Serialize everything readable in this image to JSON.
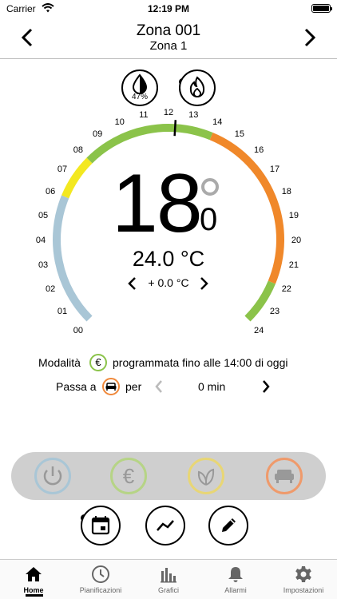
{
  "status": {
    "carrier": "Carrier",
    "time": "12:19 PM"
  },
  "header": {
    "title": "Zona 001",
    "subtitle": "Zona 1"
  },
  "humidity": {
    "value": "47%"
  },
  "gauge": {
    "hours": [
      "00",
      "01",
      "02",
      "03",
      "04",
      "05",
      "06",
      "07",
      "08",
      "09",
      "10",
      "11",
      "12",
      "13",
      "14",
      "15",
      "16",
      "17",
      "18",
      "19",
      "20",
      "21",
      "22",
      "23",
      "24"
    ],
    "segments": [
      {
        "from": 0,
        "to": 6,
        "color": "#a9c6d6"
      },
      {
        "from": 6,
        "to": 8,
        "color": "#f3e820"
      },
      {
        "from": 8,
        "to": 14,
        "color": "#8bc34a"
      },
      {
        "from": 14,
        "to": 22,
        "color": "#f0882a"
      },
      {
        "from": 22,
        "to": 24,
        "color": "#8bc34a"
      }
    ],
    "current_hour": 12.3
  },
  "setpoint": {
    "integer": "18",
    "decimal": "0"
  },
  "measured": "24.0 °C",
  "offset": "+ 0.0 °C",
  "mode": {
    "label": "Modalità",
    "description": "programmata fino alle 14:00 di oggi",
    "euro_symbol": "€"
  },
  "switch": {
    "label": "Passa a",
    "per": "per",
    "duration": "0 min"
  },
  "mode_bar": {
    "eco_symbol": "€"
  },
  "tabs": [
    {
      "label": "Home"
    },
    {
      "label": "Pianificazioni"
    },
    {
      "label": "Grafici"
    },
    {
      "label": "Allarmi"
    },
    {
      "label": "Impostazioni"
    }
  ]
}
